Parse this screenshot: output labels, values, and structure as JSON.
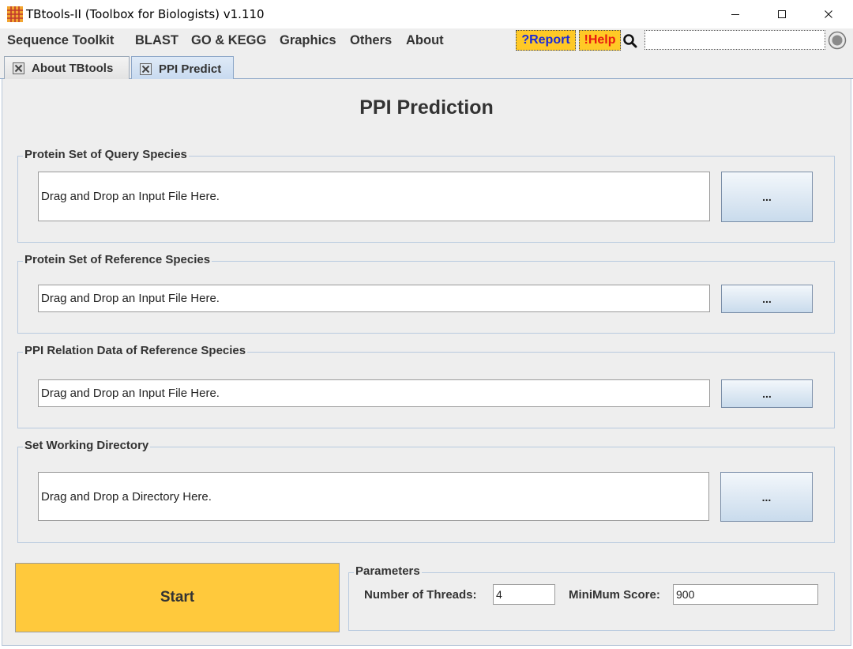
{
  "window": {
    "title": "TBtools-II (Toolbox for Biologists) v1.110",
    "icon": "tbtools-grid-icon"
  },
  "menu": {
    "items": [
      "Sequence Toolkit",
      "BLAST",
      "GO & KEGG",
      "Graphics",
      "Others",
      "About"
    ],
    "report_label": "?Report",
    "help_label": "!Help",
    "search_placeholder": ""
  },
  "tabs": [
    {
      "label": "About TBtools",
      "active": false
    },
    {
      "label": "PPI Predict",
      "active": true
    }
  ],
  "main": {
    "title": "PPI Prediction",
    "groups": [
      {
        "title": "Protein Set of Query Species",
        "field_value": "Drag and Drop an Input File Here.",
        "button_label": "..."
      },
      {
        "title": "Protein Set of Reference Species",
        "field_value": "Drag and Drop an Input File Here.",
        "button_label": "..."
      },
      {
        "title": "PPI Relation Data of Reference Species",
        "field_value": "Drag and Drop an Input File Here.",
        "button_label": "..."
      },
      {
        "title": "Set Working Directory",
        "field_value": "Drag and Drop a Directory Here.",
        "button_label": "..."
      }
    ],
    "start_label": "Start",
    "parameters": {
      "title": "Parameters",
      "threads_label": "Number of Threads:",
      "threads_value": "4",
      "min_score_label": "MiniMum Score:",
      "min_score_value": "900"
    }
  },
  "colors": {
    "start_button": "#ffc93c",
    "report_help_bg": "#ffc926",
    "report_text": "#1a2ad8",
    "help_text": "#e8190f",
    "active_tab": "#c6d9ef"
  }
}
